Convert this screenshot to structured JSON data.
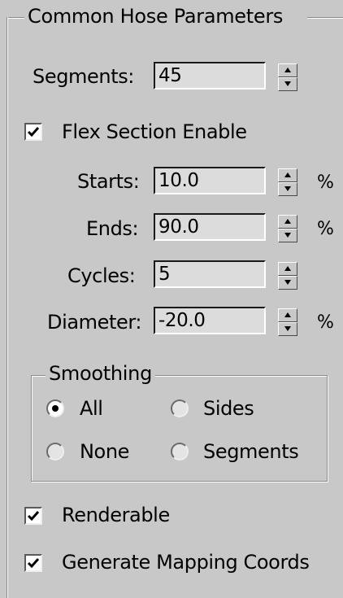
{
  "group": {
    "title": "Common Hose Parameters"
  },
  "segments": {
    "label": "Segments:",
    "value": "45"
  },
  "flex_section": {
    "label": "Flex Section Enable",
    "checked": true
  },
  "starts": {
    "label": "Starts:",
    "value": "10.0",
    "unit": "%"
  },
  "ends": {
    "label": "Ends:",
    "value": "90.0",
    "unit": "%"
  },
  "cycles": {
    "label": "Cycles:",
    "value": "5"
  },
  "diameter": {
    "label": "Diameter:",
    "value": "-20.0",
    "unit": "%"
  },
  "smoothing": {
    "title": "Smoothing",
    "options": {
      "all": {
        "label": "All",
        "selected": true
      },
      "sides": {
        "label": "Sides",
        "selected": false
      },
      "none": {
        "label": "None",
        "selected": false
      },
      "segments": {
        "label": "Segments",
        "selected": false
      }
    }
  },
  "renderable": {
    "label": "Renderable",
    "checked": true
  },
  "mapping": {
    "label": "Generate Mapping Coords",
    "checked": true
  },
  "icons": {
    "checkmark": "checkmark-icon",
    "spinner_up": "spinner-up-icon",
    "spinner_down": "spinner-down-icon"
  },
  "colors": {
    "panel_bg": "#c8c8c8",
    "field_bg": "#dcdcdc"
  }
}
